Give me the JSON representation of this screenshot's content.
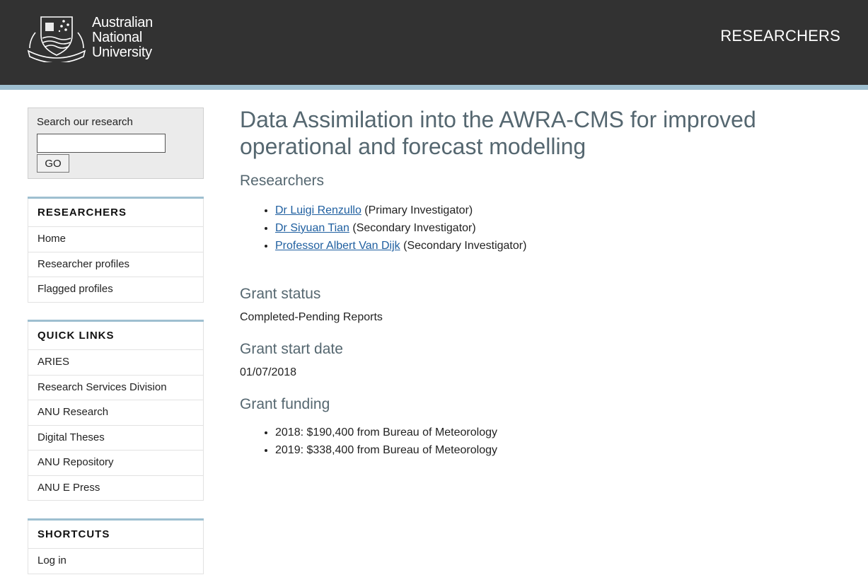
{
  "header": {
    "logo_lines": [
      "Australian",
      "National",
      "University"
    ],
    "site_title": "RESEARCHERS"
  },
  "sidebar": {
    "search": {
      "label": "Search our research",
      "value": "",
      "button": "GO"
    },
    "blocks": [
      {
        "title": "RESEARCHERS",
        "items": [
          "Home",
          "Researcher profiles",
          "Flagged profiles"
        ]
      },
      {
        "title": "QUICK LINKS",
        "items": [
          "ARIES",
          "Research Services Division",
          "ANU Research",
          "Digital Theses",
          "ANU Repository",
          "ANU E Press"
        ]
      },
      {
        "title": "SHORTCUTS",
        "items": [
          "Log in"
        ]
      }
    ]
  },
  "main": {
    "title_line1": "Data Assimilation into the AWRA-CMS for improved",
    "title_line2": "operational and forecast modelling",
    "researchers_heading": "Researchers",
    "researchers": [
      {
        "name": "Dr Luigi Renzullo",
        "role": "(Primary Investigator)"
      },
      {
        "name": "Dr Siyuan Tian",
        "role": "(Secondary Investigator)"
      },
      {
        "name": "Professor Albert Van Dijk",
        "role": "(Secondary Investigator)"
      }
    ],
    "status_heading": "Grant status",
    "status_value": "Completed-Pending Reports",
    "start_heading": "Grant start date",
    "start_value": "01/07/2018",
    "funding_heading": "Grant funding",
    "funding": [
      "2018: $190,400 from Bureau of Meteorology",
      "2019: $338,400 from Bureau of Meteorology"
    ]
  },
  "colors": {
    "header_bg": "#323232",
    "accent_rule": "#9ebfd0",
    "heading": "#556770",
    "link": "#1f5fa0"
  }
}
